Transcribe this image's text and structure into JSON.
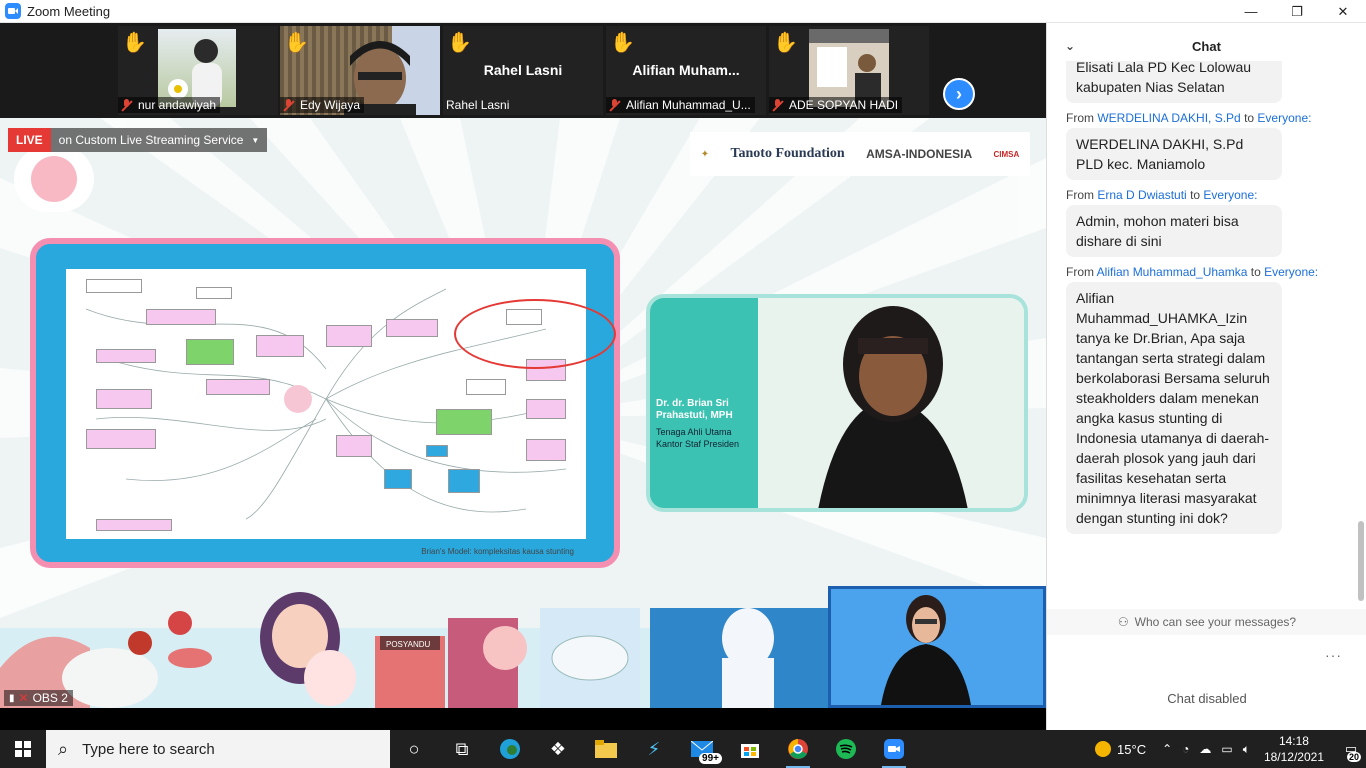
{
  "window": {
    "title": "Zoom Meeting",
    "controls": [
      "—",
      "❐",
      "✕"
    ]
  },
  "participants": [
    {
      "name": "nur andawiyah",
      "display": "photo",
      "hand_raised": true
    },
    {
      "name": "Edy Wijaya",
      "display": "photo",
      "hand_raised": true
    },
    {
      "name": "Rahel Lasni",
      "display": "text",
      "big_name": "Rahel Lasni",
      "hand_raised": true
    },
    {
      "name": "Alifian Muhammad_U...",
      "display": "text",
      "big_name": "Alifian  Muham...",
      "hand_raised": true
    },
    {
      "name": "ADE SOPYAN HADI",
      "display": "photo",
      "hand_raised": true
    }
  ],
  "share": {
    "live_label": "LIVE",
    "stream_label": "on Custom Live Streaming Service",
    "logos": {
      "tanoto": "Tanoto\nFoundation",
      "amsa": "AMSA-INDONESIA",
      "cimsa": "CIMSA"
    },
    "slide_caption": "Brian's Model: kompleksitas kausa stunting",
    "speaker_name": "Dr. dr. Brian Sri Prahastuti, MPH",
    "speaker_role": "Tenaga Ahli Utama Kantor Staf Presiden",
    "obs_label": "OBS 2"
  },
  "chat": {
    "title": "Chat",
    "messages": [
      {
        "from": "",
        "to": "",
        "text": "Elisati Lala PD Kec Lolowau kabupaten Nias Selatan"
      },
      {
        "from": "WERDELINA DAKHI, S.Pd",
        "to": "Everyone:",
        "text": "WERDELINA DAKHI, S.Pd PLD kec. Maniamolo"
      },
      {
        "from": "Erna D Dwiastuti",
        "to": "Everyone:",
        "text": "Admin, mohon materi bisa dishare di sini"
      },
      {
        "from": "Alifian Muhammad_Uhamka",
        "to": "Everyone:",
        "text": "Alifian Muhammad_UHAMKA_Izin tanya ke Dr.Brian, Apa saja tantangan serta strategi dalam berkolaborasi Bersama seluruh steakholders dalam menekan angka kasus stunting di Indonesia utamanya di daerah-daerah plosok yang jauh dari fasilitas kesehatan serta minimnya literasi masyarakat dengan stunting ini dok?"
      }
    ],
    "from_label": "From",
    "to_label": "to",
    "who_can_see": "Who can see your messages?",
    "disabled_text": "Chat disabled"
  },
  "taskbar": {
    "search_placeholder": "Type here to search",
    "mail_badge": "99+",
    "temperature": "15°C",
    "time": "14:18",
    "date": "18/12/2021",
    "notification_count": "20"
  }
}
